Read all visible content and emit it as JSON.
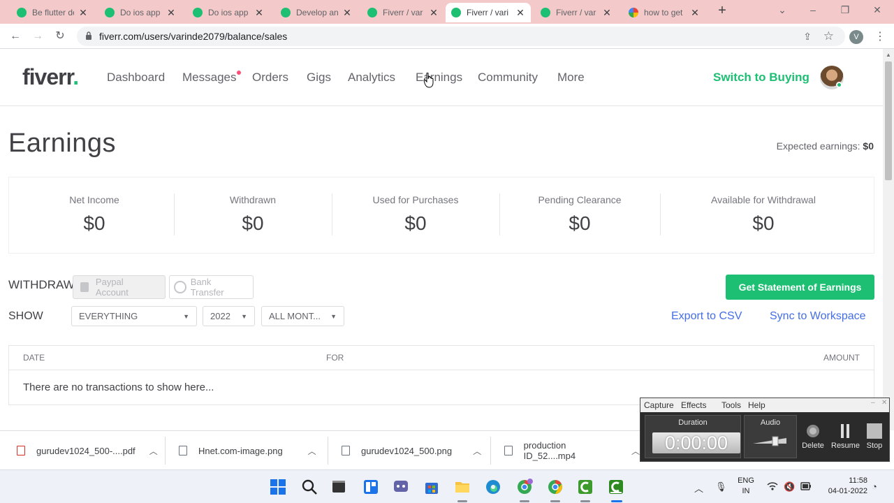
{
  "browser": {
    "tabs": [
      {
        "title": "Be flutter de",
        "icon": "fiverr-favicon",
        "active": false
      },
      {
        "title": "Do ios app",
        "icon": "fiverr-favicon",
        "active": false
      },
      {
        "title": "Do ios app",
        "icon": "fiverr-favicon",
        "active": false
      },
      {
        "title": "Develop an",
        "icon": "fiverr-favicon",
        "active": false
      },
      {
        "title": "Fiverr / var",
        "icon": "fiverr-favicon",
        "active": false
      },
      {
        "title": "Fiverr / vari",
        "icon": "fiverr-favicon",
        "active": true
      },
      {
        "title": "Fiverr / var",
        "icon": "fiverr-favicon",
        "active": false
      },
      {
        "title": "how to get",
        "icon": "google-favicon",
        "active": false
      }
    ],
    "url": "fiverr.com/users/varinde2079/balance/sales",
    "profile_initial": "V",
    "tab_strip_color": "#f4c9c9"
  },
  "header": {
    "logo_text": "fiverr",
    "logo_dot": ".",
    "nav": {
      "dashboard": "Dashboard",
      "messages": "Messages",
      "orders": "Orders",
      "gigs": "Gigs",
      "analytics": "Analytics",
      "earnings": "Earnings",
      "community": "Community",
      "more": "More"
    },
    "switch_label": "Switch to Buying"
  },
  "page": {
    "title": "Earnings",
    "expected_label": "Expected earnings:",
    "expected_value": "$0"
  },
  "summary": [
    {
      "label": "Net Income",
      "value": "$0"
    },
    {
      "label": "Withdrawn",
      "value": "$0"
    },
    {
      "label": "Used for Purchases",
      "value": "$0"
    },
    {
      "label": "Pending Clearance",
      "value": "$0"
    },
    {
      "label": "Available for Withdrawal",
      "value": "$0"
    }
  ],
  "withdraw": {
    "label": "WITHDRAW",
    "paypal": "Paypal Account",
    "bank": "Bank Transfer",
    "statement_button": "Get Statement of Earnings"
  },
  "filters": {
    "show_label": "SHOW",
    "type": "EVERYTHING",
    "year": "2022",
    "month": "ALL MONT...",
    "export": "Export to CSV",
    "sync": "Sync to Workspace"
  },
  "table": {
    "headers": [
      "DATE",
      "FOR",
      "AMOUNT"
    ],
    "empty_message": "There are no transactions to show here..."
  },
  "recorder": {
    "menu": [
      "Capture",
      "Effects",
      "Tools",
      "Help"
    ],
    "duration_label": "Duration",
    "duration_value": "0:00:00",
    "audio_label": "Audio",
    "delete": "Delete",
    "resume": "Resume",
    "stop": "Stop"
  },
  "downloads": [
    {
      "name": "gurudev1024_500-....pdf",
      "icon": "pdf-file-icon"
    },
    {
      "name": "Hnet.com-image.png",
      "icon": "image-file-icon"
    },
    {
      "name": "gurudev1024_500.png",
      "icon": "image-file-icon"
    },
    {
      "name": "production ID_52....mp4",
      "icon": "video-file-icon"
    }
  ],
  "taskbar": {
    "lang_top": "ENG",
    "lang_bottom": "IN",
    "time": "11:58",
    "date": "04-01-2022"
  },
  "colors": {
    "brand_green": "#1dbf73",
    "link_blue": "#446ee7",
    "notification_pink": "#ff4e7a"
  }
}
